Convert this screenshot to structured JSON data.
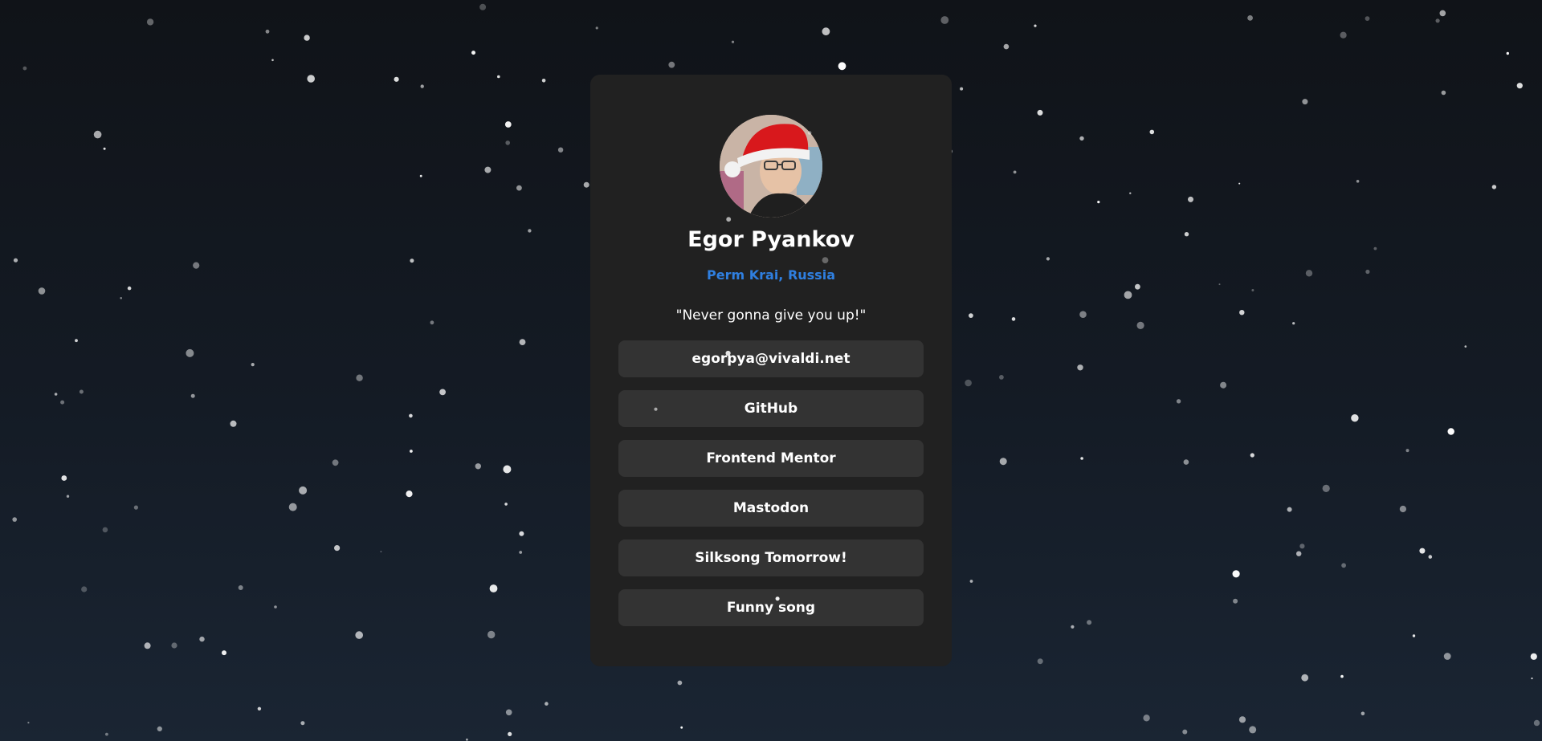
{
  "profile": {
    "name": "Egor Pyankov",
    "location": "Perm Krai, Russia",
    "quote": "\"Never gonna give you up!\""
  },
  "links": [
    {
      "label": "egorpya@vivaldi.net"
    },
    {
      "label": "GitHub"
    },
    {
      "label": "Frontend Mentor"
    },
    {
      "label": "Mastodon"
    },
    {
      "label": "Silksong Tomorrow!"
    },
    {
      "label": "Funny song"
    }
  ],
  "colors": {
    "background_top": "#101318",
    "background_bottom": "#1a2533",
    "card": "#212121",
    "button": "#333333",
    "accent": "#2f7fe0",
    "text": "#ffffff"
  },
  "icons": {
    "avatar": "avatar-santa-hat"
  }
}
